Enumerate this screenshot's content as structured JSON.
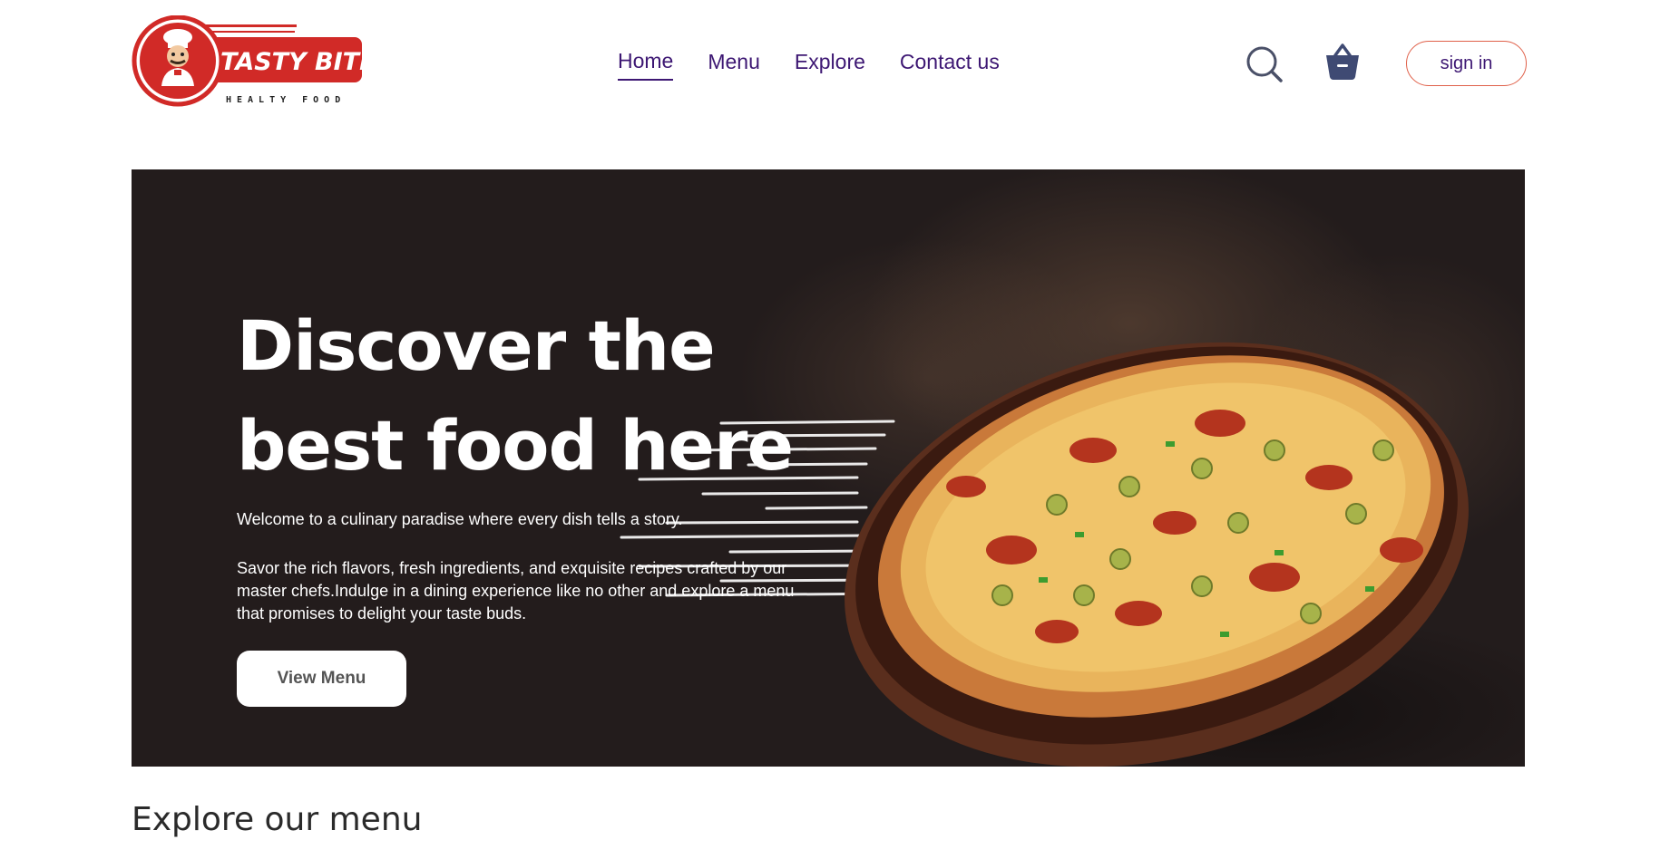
{
  "logo": {
    "name": "TASTY BITE",
    "tagline": "HEALTY FOOD"
  },
  "nav": {
    "items": [
      {
        "label": "Home",
        "active": true
      },
      {
        "label": "Menu",
        "active": false
      },
      {
        "label": "Explore",
        "active": false
      },
      {
        "label": "Contact us",
        "active": false
      }
    ]
  },
  "header": {
    "search_icon": "search-icon",
    "basket_icon": "basket-icon",
    "signin_label": "sign in"
  },
  "hero": {
    "title_line1": "Discover the",
    "title_line2": "best food here",
    "subtitle1": "Welcome to a culinary paradise where every dish tells a story.",
    "subtitle2": "Savor the rich flavors, fresh ingredients, and exquisite recipes crafted by our master chefs.Indulge in a dining experience like no other and explore a menu that promises to delight your taste buds.",
    "cta_label": "View Menu"
  },
  "section": {
    "title": "Explore our menu"
  },
  "colors": {
    "nav_text": "#3d1773",
    "accent": "#e0614a",
    "hero_bg": "#231c1c",
    "logo_red": "#d12a27"
  }
}
